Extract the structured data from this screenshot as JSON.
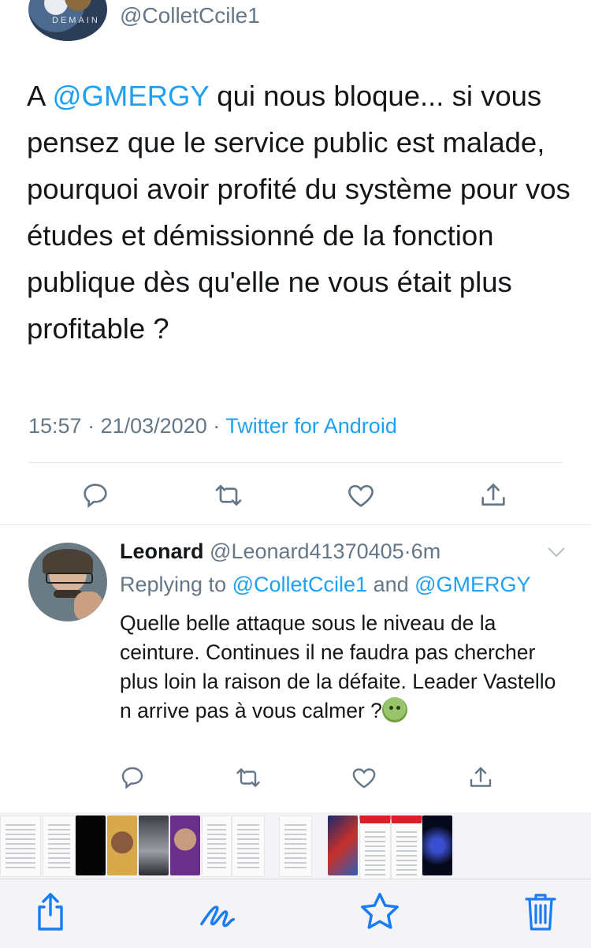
{
  "tweet": {
    "handle": "@ColletCcile1",
    "text_prefix": "A ",
    "mention": "@GMERGY",
    "text_rest": " qui nous bloque... si vous pensez que le service public est malade, pourquoi avoir profité du système pour vos études et démissionné de la fonction publique dès qu'elle ne vous était plus profitable ?",
    "time": "15:57",
    "date": "21/03/2020",
    "source": "Twitter for Android",
    "dot": " · "
  },
  "reply": {
    "name": "Leonard",
    "handle": "@Leonard41370405",
    "dot": "·",
    "age": "6m",
    "replying_prefix": "Replying to ",
    "replying_user1": "@ColletCcile1",
    "replying_and": " and ",
    "replying_user2": "@GMERGY",
    "text": "Quelle belle attaque sous le niveau de la ceinture. Continues il ne faudra pas chercher plus loin la raison de la défaite. Leader Vastello n arrive pas à vous calmer ?",
    "emoji": "nauseated-face-emoji"
  },
  "icons": {
    "reply": "reply-icon",
    "retweet": "retweet-icon",
    "like": "heart-icon",
    "share": "share-icon",
    "chevron": "chevron-down-icon",
    "toolbar_share": "share-icon",
    "toolbar_markup": "markup-pen-icon",
    "toolbar_favorite": "star-icon",
    "toolbar_delete": "trash-icon"
  },
  "colors": {
    "accent": "#1da1f2",
    "secondary_text": "#657786",
    "ios_blue": "#1a7cf5"
  }
}
